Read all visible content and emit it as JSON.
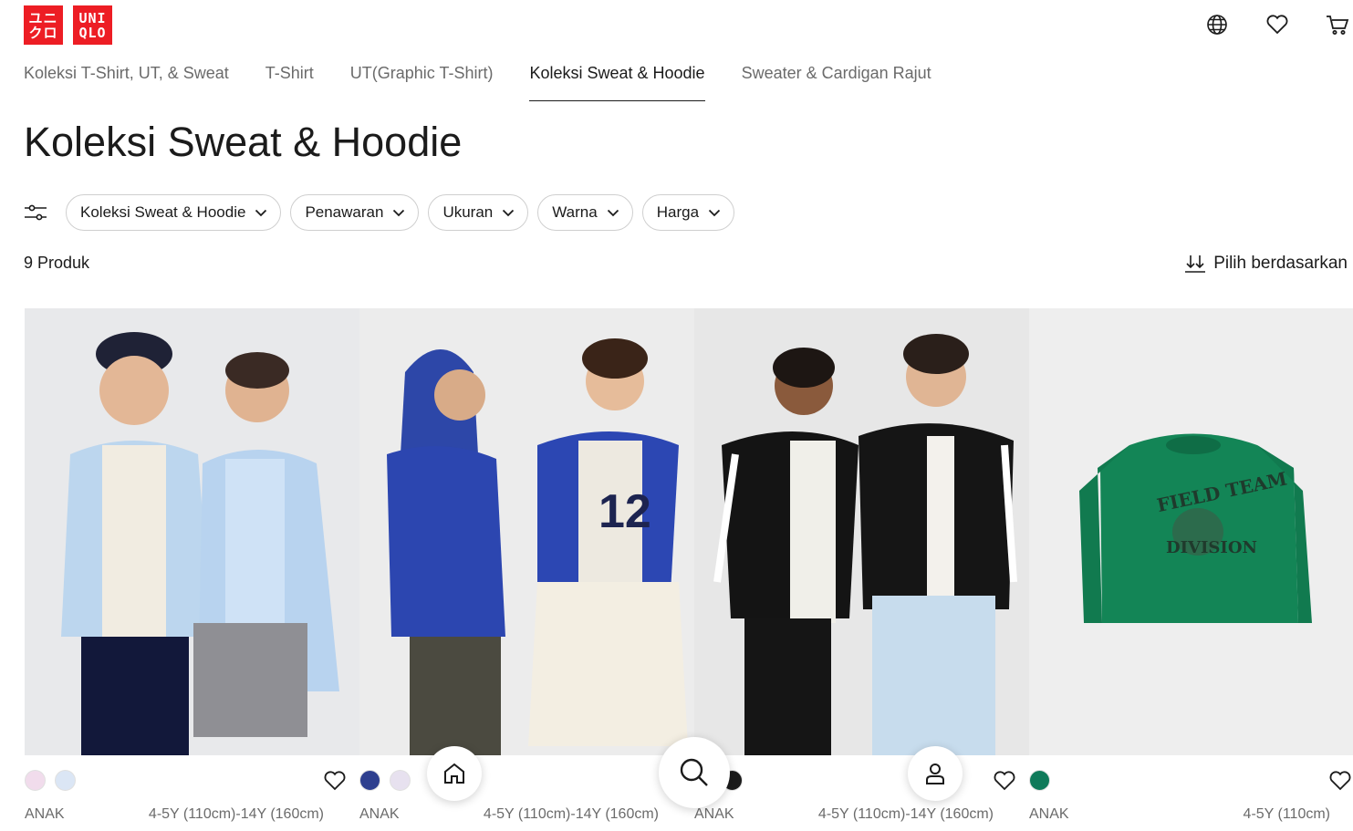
{
  "brand": {
    "logo_kana": [
      "ユニ",
      "クロ"
    ],
    "logo_latin": [
      "UNI",
      "QLO"
    ],
    "color": "#ed1d24"
  },
  "header": {
    "icons": [
      "globe-icon",
      "heart-icon",
      "cart-icon"
    ]
  },
  "category_tabs": [
    {
      "label": "Koleksi T-Shirt, UT, & Sweat",
      "active": false
    },
    {
      "label": "T-Shirt",
      "active": false
    },
    {
      "label": "UT(Graphic T-Shirt)",
      "active": false
    },
    {
      "label": "Koleksi Sweat & Hoodie",
      "active": true
    },
    {
      "label": "Sweater & Cardigan Rajut",
      "active": false
    }
  ],
  "page_title": "Koleksi Sweat & Hoodie",
  "filters": [
    {
      "label": "Koleksi Sweat & Hoodie"
    },
    {
      "label": "Penawaran"
    },
    {
      "label": "Ukuran"
    },
    {
      "label": "Warna"
    },
    {
      "label": "Harga"
    }
  ],
  "product_count": "9 Produk",
  "sort_label": "Pilih berdasarkan",
  "products": [
    {
      "gender": "ANAK",
      "sizes": "4-5Y (110cm)-14Y (160cm)",
      "swatches": [
        "#f1dcec",
        "#dbe6f5"
      ]
    },
    {
      "gender": "ANAK",
      "sizes": "4-5Y (110cm)-14Y (160cm)",
      "swatches": [
        "#2e3f8f",
        "#e7e1ef"
      ]
    },
    {
      "gender": "ANAK",
      "sizes": "4-5Y (110cm)-14Y (160cm)",
      "swatches": [
        "#1b1b1b"
      ]
    },
    {
      "gender": "ANAK",
      "sizes": "4-5Y (110cm)",
      "swatches": [
        "#0f7a5a"
      ]
    }
  ],
  "floating_nav": [
    "home-icon",
    "search-icon",
    "user-icon"
  ]
}
